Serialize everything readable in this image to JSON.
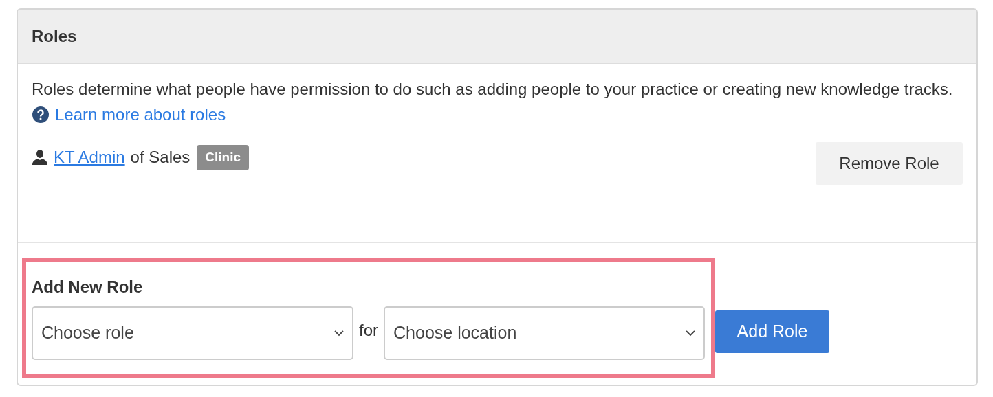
{
  "panel": {
    "title": "Roles"
  },
  "description": "Roles determine what people have permission to do such as adding people to your practice or creating new knowledge tracks.",
  "help_link": "Learn more about roles",
  "roles": [
    {
      "role": "KT Admin",
      "connector": "of Sales",
      "badge": "Clinic",
      "remove_button": "Remove Role"
    }
  ],
  "add_role": {
    "heading": "Add New Role",
    "highlighted": true,
    "role_select": {
      "placeholder": "Choose role"
    },
    "connector": "for",
    "location_select": {
      "placeholder": "Choose location"
    },
    "button": "Add Role"
  }
}
